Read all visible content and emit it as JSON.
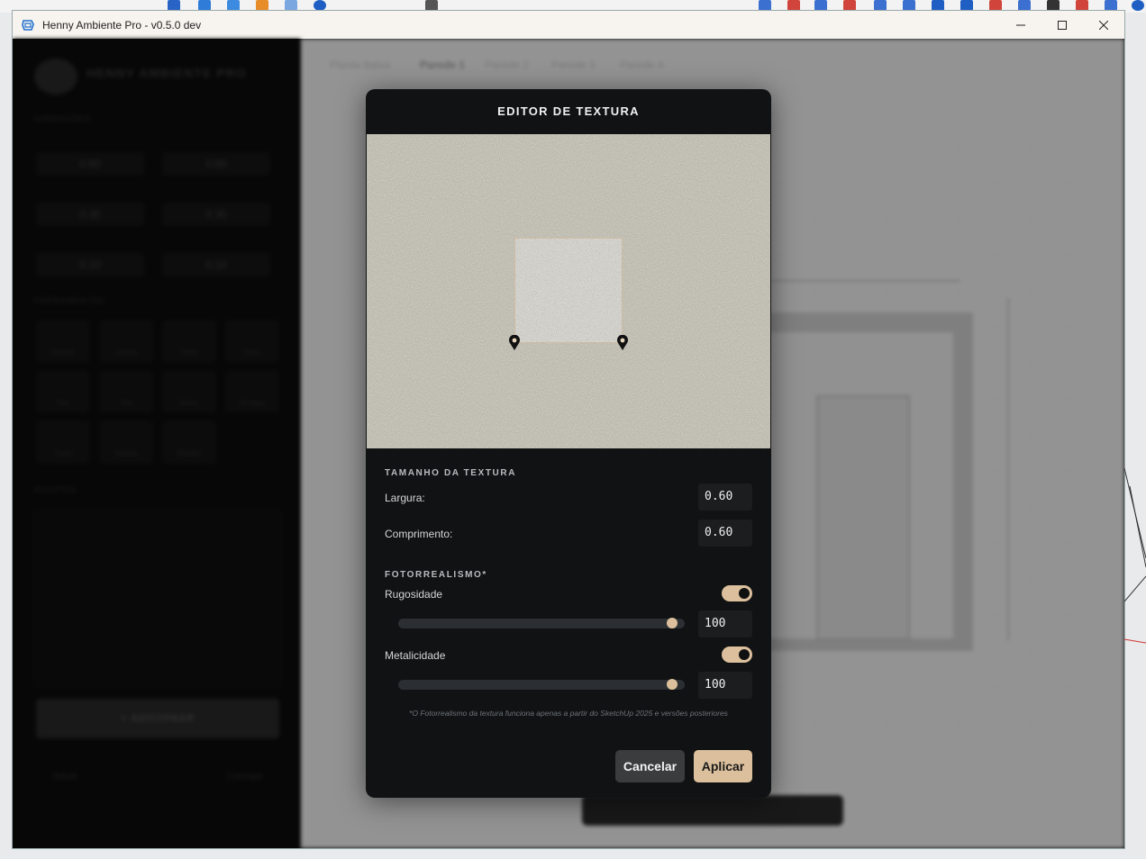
{
  "window": {
    "title": "Henny Ambiente Pro - v0.5.0 dev",
    "minimize_label": "minimize",
    "maximize_label": "maximize",
    "close_label": "close"
  },
  "sidebar": {
    "logo_text": "HENNY AMBIENTE PRO",
    "section_dims": "DIMENSÕES",
    "fields": [
      "0.60",
      "0.60",
      "0.30",
      "0.30",
      "0.10",
      "0.10"
    ],
    "section_tools": "FERRAMENTAS",
    "tools": [
      "Parede",
      "Janela",
      "Porta",
      "Forro",
      "Piso",
      "Vão",
      "Nicho",
      "Rodapé",
      "Cotas",
      "Textura",
      "Render"
    ],
    "section_settings": "AJUSTES",
    "big_button": "+ ADICIONAR",
    "footer_left": "Salvar",
    "footer_right": "Carregar"
  },
  "canvas": {
    "tabs": [
      "Planta Baixa",
      "Parede 1",
      "Parede 2",
      "Parede 3",
      "Parede 4"
    ]
  },
  "modal": {
    "title": "EDITOR DE TEXTURA",
    "size_section": "TAMANHO DA TEXTURA",
    "width_label": "Largura:",
    "width_value": "0.60",
    "length_label": "Comprimento:",
    "length_value": "0.60",
    "photo_section": "FOTORREALISMO*",
    "roughness_label": "Rugosidade",
    "roughness_enabled": true,
    "roughness_value": "100",
    "roughness_level": 100,
    "metallic_label": "Metalicidade",
    "metallic_enabled": true,
    "metallic_value": "100",
    "metallic_level": 100,
    "footnote": "*O Fotorrealismo da textura funciona apenas a partir do SketchUp 2025 e versões posteriores",
    "cancel_label": "Cancelar",
    "apply_label": "Aplicar"
  },
  "colors": {
    "accent": "#dcc09d",
    "modal_bg": "#101213",
    "field_bg": "#1b1d1f"
  }
}
